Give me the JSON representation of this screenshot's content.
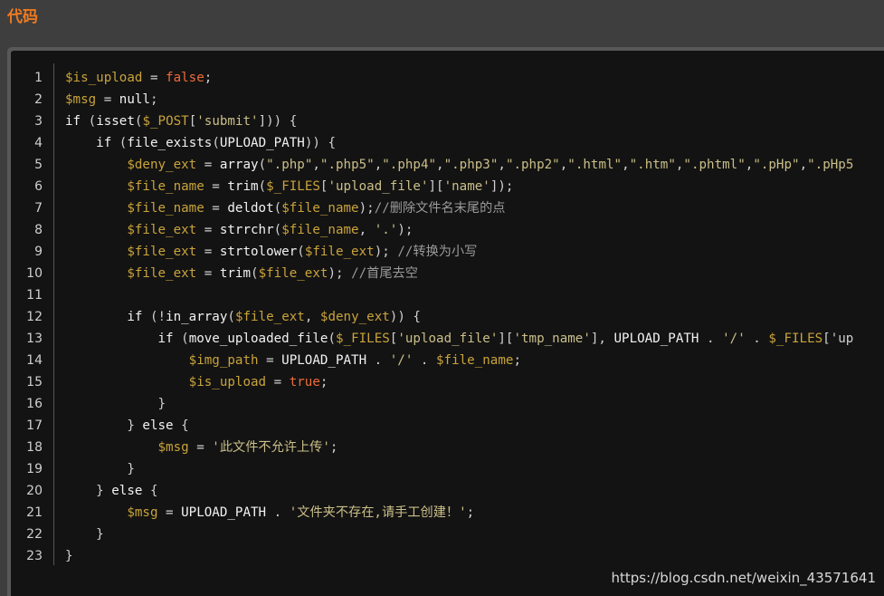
{
  "header": {
    "title": "代码"
  },
  "code": {
    "line_numbers": [
      "1",
      "2",
      "3",
      "4",
      "5",
      "6",
      "7",
      "8",
      "9",
      "10",
      "11",
      "12",
      "13",
      "14",
      "15",
      "16",
      "17",
      "18",
      "19",
      "20",
      "21",
      "22",
      "23"
    ],
    "lines": [
      [
        {
          "t": "v",
          "x": "$is_upload"
        },
        {
          "t": "p",
          "x": " = "
        },
        {
          "t": "b",
          "x": "false"
        },
        {
          "t": "p",
          "x": ";"
        }
      ],
      [
        {
          "t": "v",
          "x": "$msg"
        },
        {
          "t": "p",
          "x": " = "
        },
        {
          "t": "n",
          "x": "null"
        },
        {
          "t": "p",
          "x": ";"
        }
      ],
      [
        {
          "t": "k",
          "x": "if"
        },
        {
          "t": "p",
          "x": " ("
        },
        {
          "t": "f",
          "x": "isset"
        },
        {
          "t": "p",
          "x": "("
        },
        {
          "t": "v",
          "x": "$_POST"
        },
        {
          "t": "p",
          "x": "["
        },
        {
          "t": "s",
          "x": "'submit'"
        },
        {
          "t": "p",
          "x": "])) {"
        }
      ],
      [
        {
          "t": "p",
          "x": "    "
        },
        {
          "t": "k",
          "x": "if"
        },
        {
          "t": "p",
          "x": " ("
        },
        {
          "t": "f",
          "x": "file_exists"
        },
        {
          "t": "p",
          "x": "("
        },
        {
          "t": "n",
          "x": "UPLOAD_PATH"
        },
        {
          "t": "p",
          "x": ")) {"
        }
      ],
      [
        {
          "t": "p",
          "x": "        "
        },
        {
          "t": "v",
          "x": "$deny_ext"
        },
        {
          "t": "p",
          "x": " = "
        },
        {
          "t": "f",
          "x": "array"
        },
        {
          "t": "p",
          "x": "("
        },
        {
          "t": "s",
          "x": "\".php\""
        },
        {
          "t": "p",
          "x": ","
        },
        {
          "t": "s",
          "x": "\".php5\""
        },
        {
          "t": "p",
          "x": ","
        },
        {
          "t": "s",
          "x": "\".php4\""
        },
        {
          "t": "p",
          "x": ","
        },
        {
          "t": "s",
          "x": "\".php3\""
        },
        {
          "t": "p",
          "x": ","
        },
        {
          "t": "s",
          "x": "\".php2\""
        },
        {
          "t": "p",
          "x": ","
        },
        {
          "t": "s",
          "x": "\".html\""
        },
        {
          "t": "p",
          "x": ","
        },
        {
          "t": "s",
          "x": "\".htm\""
        },
        {
          "t": "p",
          "x": ","
        },
        {
          "t": "s",
          "x": "\".phtml\""
        },
        {
          "t": "p",
          "x": ","
        },
        {
          "t": "s",
          "x": "\".pHp\""
        },
        {
          "t": "p",
          "x": ","
        },
        {
          "t": "s",
          "x": "\".pHp5"
        }
      ],
      [
        {
          "t": "p",
          "x": "        "
        },
        {
          "t": "v",
          "x": "$file_name"
        },
        {
          "t": "p",
          "x": " = "
        },
        {
          "t": "f",
          "x": "trim"
        },
        {
          "t": "p",
          "x": "("
        },
        {
          "t": "v",
          "x": "$_FILES"
        },
        {
          "t": "p",
          "x": "["
        },
        {
          "t": "s",
          "x": "'upload_file'"
        },
        {
          "t": "p",
          "x": "]["
        },
        {
          "t": "s",
          "x": "'name'"
        },
        {
          "t": "p",
          "x": "]);"
        }
      ],
      [
        {
          "t": "p",
          "x": "        "
        },
        {
          "t": "v",
          "x": "$file_name"
        },
        {
          "t": "p",
          "x": " = "
        },
        {
          "t": "f",
          "x": "deldot"
        },
        {
          "t": "p",
          "x": "("
        },
        {
          "t": "v",
          "x": "$file_name"
        },
        {
          "t": "p",
          "x": ");"
        },
        {
          "t": "c",
          "x": "//删除文件名末尾的点"
        }
      ],
      [
        {
          "t": "p",
          "x": "        "
        },
        {
          "t": "v",
          "x": "$file_ext"
        },
        {
          "t": "p",
          "x": " = "
        },
        {
          "t": "f",
          "x": "strrchr"
        },
        {
          "t": "p",
          "x": "("
        },
        {
          "t": "v",
          "x": "$file_name"
        },
        {
          "t": "p",
          "x": ", "
        },
        {
          "t": "s",
          "x": "'.'"
        },
        {
          "t": "p",
          "x": ");"
        }
      ],
      [
        {
          "t": "p",
          "x": "        "
        },
        {
          "t": "v",
          "x": "$file_ext"
        },
        {
          "t": "p",
          "x": " = "
        },
        {
          "t": "f",
          "x": "strtolower"
        },
        {
          "t": "p",
          "x": "("
        },
        {
          "t": "v",
          "x": "$file_ext"
        },
        {
          "t": "p",
          "x": "); "
        },
        {
          "t": "c",
          "x": "//转换为小写"
        }
      ],
      [
        {
          "t": "p",
          "x": "        "
        },
        {
          "t": "v",
          "x": "$file_ext"
        },
        {
          "t": "p",
          "x": " = "
        },
        {
          "t": "f",
          "x": "trim"
        },
        {
          "t": "p",
          "x": "("
        },
        {
          "t": "v",
          "x": "$file_ext"
        },
        {
          "t": "p",
          "x": "); "
        },
        {
          "t": "c",
          "x": "//首尾去空"
        }
      ],
      [],
      [
        {
          "t": "p",
          "x": "        "
        },
        {
          "t": "k",
          "x": "if"
        },
        {
          "t": "p",
          "x": " (!"
        },
        {
          "t": "f",
          "x": "in_array"
        },
        {
          "t": "p",
          "x": "("
        },
        {
          "t": "v",
          "x": "$file_ext"
        },
        {
          "t": "p",
          "x": ", "
        },
        {
          "t": "v",
          "x": "$deny_ext"
        },
        {
          "t": "p",
          "x": ")) {"
        }
      ],
      [
        {
          "t": "p",
          "x": "            "
        },
        {
          "t": "k",
          "x": "if"
        },
        {
          "t": "p",
          "x": " ("
        },
        {
          "t": "f",
          "x": "move_uploaded_file"
        },
        {
          "t": "p",
          "x": "("
        },
        {
          "t": "v",
          "x": "$_FILES"
        },
        {
          "t": "p",
          "x": "["
        },
        {
          "t": "s",
          "x": "'upload_file'"
        },
        {
          "t": "p",
          "x": "]["
        },
        {
          "t": "s",
          "x": "'tmp_name'"
        },
        {
          "t": "p",
          "x": "], "
        },
        {
          "t": "n",
          "x": "UPLOAD_PATH"
        },
        {
          "t": "p",
          "x": " . "
        },
        {
          "t": "s",
          "x": "'/'"
        },
        {
          "t": "p",
          "x": " . "
        },
        {
          "t": "v",
          "x": "$_FILES"
        },
        {
          "t": "p",
          "x": "['up"
        }
      ],
      [
        {
          "t": "p",
          "x": "                "
        },
        {
          "t": "v",
          "x": "$img_path"
        },
        {
          "t": "p",
          "x": " = "
        },
        {
          "t": "n",
          "x": "UPLOAD_PATH"
        },
        {
          "t": "p",
          "x": " . "
        },
        {
          "t": "s",
          "x": "'/'"
        },
        {
          "t": "p",
          "x": " . "
        },
        {
          "t": "v",
          "x": "$file_name"
        },
        {
          "t": "p",
          "x": ";"
        }
      ],
      [
        {
          "t": "p",
          "x": "                "
        },
        {
          "t": "v",
          "x": "$is_upload"
        },
        {
          "t": "p",
          "x": " = "
        },
        {
          "t": "b",
          "x": "true"
        },
        {
          "t": "p",
          "x": ";"
        }
      ],
      [
        {
          "t": "p",
          "x": "            }"
        }
      ],
      [
        {
          "t": "p",
          "x": "        } "
        },
        {
          "t": "k",
          "x": "else"
        },
        {
          "t": "p",
          "x": " {"
        }
      ],
      [
        {
          "t": "p",
          "x": "            "
        },
        {
          "t": "v",
          "x": "$msg"
        },
        {
          "t": "p",
          "x": " = "
        },
        {
          "t": "s",
          "x": "'此文件不允许上传'"
        },
        {
          "t": "p",
          "x": ";"
        }
      ],
      [
        {
          "t": "p",
          "x": "        }"
        }
      ],
      [
        {
          "t": "p",
          "x": "    } "
        },
        {
          "t": "k",
          "x": "else"
        },
        {
          "t": "p",
          "x": " {"
        }
      ],
      [
        {
          "t": "p",
          "x": "        "
        },
        {
          "t": "v",
          "x": "$msg"
        },
        {
          "t": "p",
          "x": " = "
        },
        {
          "t": "n",
          "x": "UPLOAD_PATH"
        },
        {
          "t": "p",
          "x": " . "
        },
        {
          "t": "s",
          "x": "'文件夹不存在,请手工创建！'"
        },
        {
          "t": "p",
          "x": ";"
        }
      ],
      [
        {
          "t": "p",
          "x": "    }"
        }
      ],
      [
        {
          "t": "p",
          "x": "}"
        }
      ]
    ]
  },
  "watermark": "https://blog.csdn.net/weixin_43571641",
  "colors": {
    "title_orange": "#ee7a1f",
    "variable": "#c9a33b",
    "boolean": "#ee6b3a",
    "string": "#cbbf88",
    "comment": "#9a9a9a",
    "code_bg": "#131313",
    "page_bg": "#3e3e3e"
  }
}
